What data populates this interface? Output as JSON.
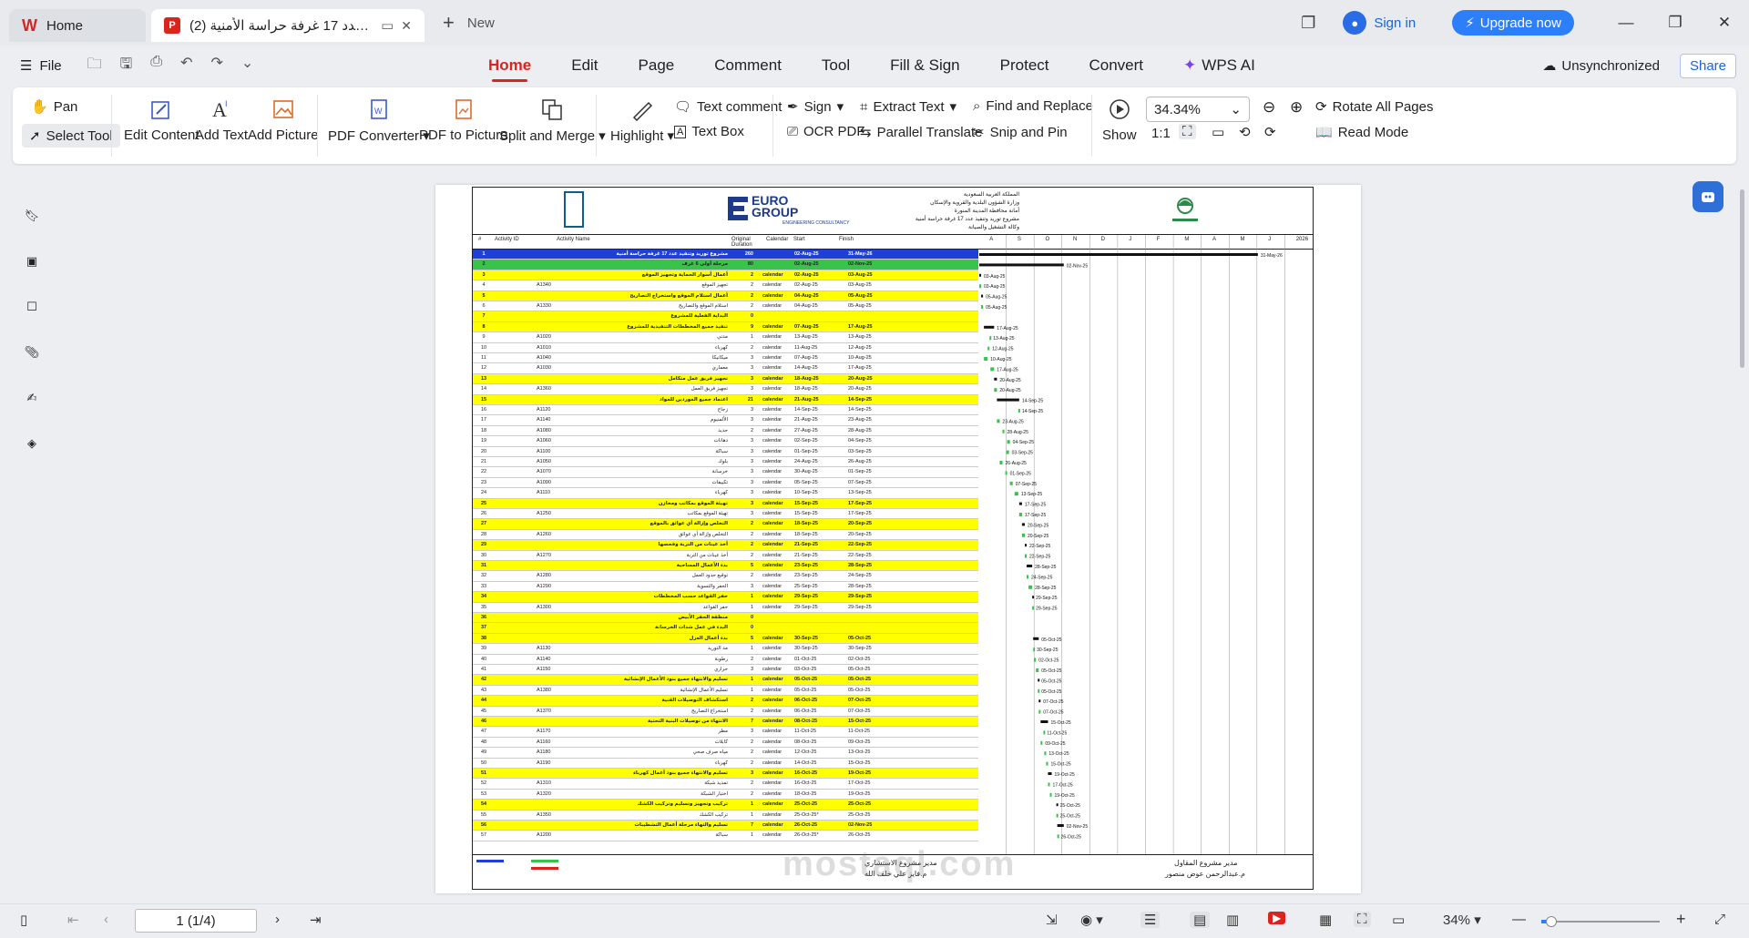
{
  "titlebar": {
    "home_tab": "Home",
    "doc_tab": "مشروع توريد وتنفيذ عدد 17 غرفة حراسة الأمنية (2)",
    "new_tab": "New",
    "sign_in": "Sign in",
    "upgrade": "Upgrade now"
  },
  "menubar": {
    "file": "File",
    "tabs": [
      "Home",
      "Edit",
      "Page",
      "Comment",
      "Tool",
      "Fill & Sign",
      "Protect",
      "Convert",
      "WPS AI"
    ],
    "unsync": "Unsynchronized",
    "share": "Share"
  },
  "ribbon": {
    "pan": "Pan",
    "select_tool": "Select Tool",
    "edit_content": "Edit Content",
    "add_text": "Add Text",
    "add_picture": "Add Picture",
    "pdf_converter": "PDF Converter",
    "pdf_to_picture": "PDF to Picture",
    "split_merge": "Split and Merge",
    "highlight": "Highlight",
    "text_comment": "Text comment",
    "text_box": "Text Box",
    "sign": "Sign",
    "ocr_pdf": "OCR PDF",
    "extract_text": "Extract Text",
    "parallel_translate": "Parallel Translate",
    "find_replace": "Find and Replace",
    "snip_pin": "Snip and Pin",
    "show": "Show",
    "zoom_value": "34.34%",
    "rotate_all": "Rotate All Pages",
    "read_mode": "Read Mode"
  },
  "document": {
    "company": "EURO\nGROUP",
    "company_sub": "ENGINEERING CONSULTANCY",
    "header_ar": "المملكة العربية السعودية\nوزارة الشؤون البلدية والقروية والإسكان\nأمانة محافظة المدينة المنورة\nمشروع توريد وتنفيذ عدد 17 غرفة حراسة أمنية\nوكالة التشغيل والصيانة",
    "col_headers": [
      "#",
      "Activity ID",
      "Activity Name",
      "Original Duration",
      "Calendar",
      "Start",
      "Finish"
    ],
    "months": [
      "A",
      "S",
      "O",
      "N",
      "D",
      "J",
      "F",
      "M",
      "A",
      "M",
      "J",
      "2026"
    ],
    "rows": [
      {
        "n": "1",
        "aid": "",
        "name": "مشروع توريد وتنفيذ عدد 17 غرفة حراسة أمنية",
        "dur": "260",
        "cal": "",
        "st": "02-Aug-25",
        "fi": "31-May-26",
        "lvl": "project"
      },
      {
        "n": "2",
        "aid": "",
        "name": "مرحلة أولى 6 غرف",
        "dur": "80",
        "cal": "",
        "st": "02-Aug-25",
        "fi": "02-Nov-25",
        "lvl": "phase"
      },
      {
        "n": "3",
        "aid": "",
        "name": "أعمال أسوار الحماية وتجهيز الموقع",
        "dur": "2",
        "cal": "calendar",
        "st": "02-Aug-25",
        "fi": "03-Aug-25",
        "lvl": "wbs"
      },
      {
        "n": "4",
        "aid": "A1340",
        "name": "تجهيز الموقع",
        "dur": "2",
        "cal": "calendar",
        "st": "02-Aug-25",
        "fi": "03-Aug-25",
        "lvl": "act"
      },
      {
        "n": "5",
        "aid": "",
        "name": "أعمال استلام الموقع واستخراج التصاريح",
        "dur": "2",
        "cal": "calendar",
        "st": "04-Aug-25",
        "fi": "05-Aug-25",
        "lvl": "wbs"
      },
      {
        "n": "6",
        "aid": "A1330",
        "name": "استلام الموقع والتصاريح",
        "dur": "2",
        "cal": "calendar",
        "st": "04-Aug-25",
        "fi": "05-Aug-25",
        "lvl": "act"
      },
      {
        "n": "7",
        "aid": "",
        "name": "البداية الفعلية للمشروع",
        "dur": "0",
        "cal": "",
        "st": "",
        "fi": "",
        "lvl": "wbs"
      },
      {
        "n": "8",
        "aid": "",
        "name": "تنفيذ جميع المخططات التنفيذية للمشروع",
        "dur": "9",
        "cal": "calendar",
        "st": "07-Aug-25",
        "fi": "17-Aug-25",
        "lvl": "wbs"
      },
      {
        "n": "9",
        "aid": "A1020",
        "name": "مدني",
        "dur": "1",
        "cal": "calendar",
        "st": "13-Aug-25",
        "fi": "13-Aug-25",
        "lvl": "act"
      },
      {
        "n": "10",
        "aid": "A1010",
        "name": "كهرباء",
        "dur": "2",
        "cal": "calendar",
        "st": "11-Aug-25",
        "fi": "12-Aug-25",
        "lvl": "act"
      },
      {
        "n": "11",
        "aid": "A1040",
        "name": "ميكانيكا",
        "dur": "3",
        "cal": "calendar",
        "st": "07-Aug-25",
        "fi": "10-Aug-25",
        "lvl": "act"
      },
      {
        "n": "12",
        "aid": "A1030",
        "name": "معماري",
        "dur": "3",
        "cal": "calendar",
        "st": "14-Aug-25",
        "fi": "17-Aug-25",
        "lvl": "act"
      },
      {
        "n": "13",
        "aid": "",
        "name": "تجهيز فريق عمل متكامل",
        "dur": "3",
        "cal": "calendar",
        "st": "18-Aug-25",
        "fi": "20-Aug-25",
        "lvl": "wbs"
      },
      {
        "n": "14",
        "aid": "A1360",
        "name": "تجهيز فريق العمل",
        "dur": "3",
        "cal": "calendar",
        "st": "18-Aug-25",
        "fi": "20-Aug-25",
        "lvl": "act"
      },
      {
        "n": "15",
        "aid": "",
        "name": "اعتماد جميع الموردين للمواد",
        "dur": "21",
        "cal": "calendar",
        "st": "21-Aug-25",
        "fi": "14-Sep-25",
        "lvl": "wbs"
      },
      {
        "n": "16",
        "aid": "A1120",
        "name": "زجاج",
        "dur": "3",
        "cal": "calendar",
        "st": "14-Sep-25",
        "fi": "14-Sep-25",
        "lvl": "act"
      },
      {
        "n": "17",
        "aid": "A1140",
        "name": "الألمنيوم",
        "dur": "3",
        "cal": "calendar",
        "st": "21-Aug-25",
        "fi": "23-Aug-25",
        "lvl": "act"
      },
      {
        "n": "18",
        "aid": "A1080",
        "name": "حديد",
        "dur": "2",
        "cal": "calendar",
        "st": "27-Aug-25",
        "fi": "28-Aug-25",
        "lvl": "act"
      },
      {
        "n": "19",
        "aid": "A1060",
        "name": "دهانات",
        "dur": "3",
        "cal": "calendar",
        "st": "02-Sep-25",
        "fi": "04-Sep-25",
        "lvl": "act"
      },
      {
        "n": "20",
        "aid": "A1100",
        "name": "سباكة",
        "dur": "3",
        "cal": "calendar",
        "st": "01-Sep-25",
        "fi": "03-Sep-25",
        "lvl": "act"
      },
      {
        "n": "21",
        "aid": "A1050",
        "name": "بلوك",
        "dur": "3",
        "cal": "calendar",
        "st": "24-Aug-25",
        "fi": "26-Aug-25",
        "lvl": "act"
      },
      {
        "n": "22",
        "aid": "A1070",
        "name": "خرسانة",
        "dur": "3",
        "cal": "calendar",
        "st": "30-Aug-25",
        "fi": "01-Sep-25",
        "lvl": "act"
      },
      {
        "n": "23",
        "aid": "A1090",
        "name": "تكييفات",
        "dur": "3",
        "cal": "calendar",
        "st": "05-Sep-25",
        "fi": "07-Sep-25",
        "lvl": "act"
      },
      {
        "n": "24",
        "aid": "A1110",
        "name": "كهرباء",
        "dur": "3",
        "cal": "calendar",
        "st": "10-Sep-25",
        "fi": "13-Sep-25",
        "lvl": "act"
      },
      {
        "n": "25",
        "aid": "",
        "name": "تهيئة الموقع بمكاتب ومخازن",
        "dur": "3",
        "cal": "calendar",
        "st": "15-Sep-25",
        "fi": "17-Sep-25",
        "lvl": "wbs"
      },
      {
        "n": "26",
        "aid": "A1250",
        "name": "تهيئة الموقع بمكاتب",
        "dur": "3",
        "cal": "calendar",
        "st": "15-Sep-25",
        "fi": "17-Sep-25",
        "lvl": "act"
      },
      {
        "n": "27",
        "aid": "",
        "name": "التخلص وإزالة أي عوائق بالموقع",
        "dur": "2",
        "cal": "calendar",
        "st": "18-Sep-25",
        "fi": "20-Sep-25",
        "lvl": "wbs"
      },
      {
        "n": "28",
        "aid": "A1260",
        "name": "التخلص وإزالة أي عوائق",
        "dur": "2",
        "cal": "calendar",
        "st": "18-Sep-25",
        "fi": "20-Sep-25",
        "lvl": "act"
      },
      {
        "n": "29",
        "aid": "",
        "name": "أخذ عينات من التربة وفحصها",
        "dur": "2",
        "cal": "calendar",
        "st": "21-Sep-25",
        "fi": "22-Sep-25",
        "lvl": "wbs"
      },
      {
        "n": "30",
        "aid": "A1270",
        "name": "أخذ عينات من التربة",
        "dur": "2",
        "cal": "calendar",
        "st": "21-Sep-25",
        "fi": "22-Sep-25",
        "lvl": "act"
      },
      {
        "n": "31",
        "aid": "",
        "name": "بدء الأعمال المساحية",
        "dur": "5",
        "cal": "calendar",
        "st": "23-Sep-25",
        "fi": "28-Sep-25",
        "lvl": "wbs"
      },
      {
        "n": "32",
        "aid": "A1280",
        "name": "توقيع حدود العمل",
        "dur": "2",
        "cal": "calendar",
        "st": "23-Sep-25",
        "fi": "24-Sep-25",
        "lvl": "act"
      },
      {
        "n": "33",
        "aid": "A1290",
        "name": "الحفر والتسوية",
        "dur": "3",
        "cal": "calendar",
        "st": "25-Sep-25",
        "fi": "28-Sep-25",
        "lvl": "act"
      },
      {
        "n": "34",
        "aid": "",
        "name": "حفر القواعد حسب المخططات",
        "dur": "1",
        "cal": "calendar",
        "st": "29-Sep-25",
        "fi": "29-Sep-25",
        "lvl": "wbs"
      },
      {
        "n": "35",
        "aid": "A1300",
        "name": "حفر القواعد",
        "dur": "1",
        "cal": "calendar",
        "st": "29-Sep-25",
        "fi": "29-Sep-25",
        "lvl": "act"
      },
      {
        "n": "36",
        "aid": "",
        "name": "منظفة الحفر الأبيض",
        "dur": "0",
        "cal": "",
        "st": "",
        "fi": "",
        "lvl": "wbs"
      },
      {
        "n": "37",
        "aid": "",
        "name": "البدء في عمل شدات الخرسانة",
        "dur": "0",
        "cal": "",
        "st": "",
        "fi": "",
        "lvl": "wbs"
      },
      {
        "n": "38",
        "aid": "",
        "name": "بدء أعمال العزل",
        "dur": "5",
        "cal": "calendar",
        "st": "30-Sep-25",
        "fi": "05-Oct-25",
        "lvl": "wbs"
      },
      {
        "n": "39",
        "aid": "A1130",
        "name": "مد التوريد",
        "dur": "1",
        "cal": "calendar",
        "st": "30-Sep-25",
        "fi": "30-Sep-25",
        "lvl": "act"
      },
      {
        "n": "40",
        "aid": "A1140",
        "name": "رطوبة",
        "dur": "2",
        "cal": "calendar",
        "st": "01-Oct-25",
        "fi": "02-Oct-25",
        "lvl": "act"
      },
      {
        "n": "41",
        "aid": "A1150",
        "name": "حراري",
        "dur": "3",
        "cal": "calendar",
        "st": "03-Oct-25",
        "fi": "05-Oct-25",
        "lvl": "act"
      },
      {
        "n": "42",
        "aid": "",
        "name": "تسليم والانتهاء جميع بنود الأعمال الإنشائية",
        "dur": "1",
        "cal": "calendar",
        "st": "05-Oct-25",
        "fi": "05-Oct-25",
        "lvl": "wbs"
      },
      {
        "n": "43",
        "aid": "A1380",
        "name": "تسليم الأعمال الإنشائية",
        "dur": "1",
        "cal": "calendar",
        "st": "05-Oct-25",
        "fi": "05-Oct-25",
        "lvl": "act"
      },
      {
        "n": "44",
        "aid": "",
        "name": "استكشاف التوصيلات الفنية",
        "dur": "2",
        "cal": "calendar",
        "st": "06-Oct-25",
        "fi": "07-Oct-25",
        "lvl": "wbs"
      },
      {
        "n": "45",
        "aid": "A1370",
        "name": "استخراج التصاريح",
        "dur": "2",
        "cal": "calendar",
        "st": "06-Oct-25",
        "fi": "07-Oct-25",
        "lvl": "act"
      },
      {
        "n": "46",
        "aid": "",
        "name": "الانتهاء من توصيلات البنية التحتية",
        "dur": "7",
        "cal": "calendar",
        "st": "08-Oct-25",
        "fi": "15-Oct-25",
        "lvl": "wbs"
      },
      {
        "n": "47",
        "aid": "A1170",
        "name": "مطر",
        "dur": "3",
        "cal": "calendar",
        "st": "11-Oct-25",
        "fi": "11-Oct-25",
        "lvl": "act"
      },
      {
        "n": "48",
        "aid": "A1160",
        "name": "كابلات",
        "dur": "2",
        "cal": "calendar",
        "st": "08-Oct-25",
        "fi": "09-Oct-25",
        "lvl": "act"
      },
      {
        "n": "49",
        "aid": "A1180",
        "name": "مياه صرف صحي",
        "dur": "2",
        "cal": "calendar",
        "st": "12-Oct-25",
        "fi": "13-Oct-25",
        "lvl": "act"
      },
      {
        "n": "50",
        "aid": "A1190",
        "name": "كهرباء",
        "dur": "2",
        "cal": "calendar",
        "st": "14-Oct-25",
        "fi": "15-Oct-25",
        "lvl": "act"
      },
      {
        "n": "51",
        "aid": "",
        "name": "تسليم والانتهاء جميع بنود أعمال كهرباء",
        "dur": "3",
        "cal": "calendar",
        "st": "16-Oct-25",
        "fi": "19-Oct-25",
        "lvl": "wbs"
      },
      {
        "n": "52",
        "aid": "A1310",
        "name": "تمديد شبكة",
        "dur": "2",
        "cal": "calendar",
        "st": "16-Oct-25",
        "fi": "17-Oct-25",
        "lvl": "act"
      },
      {
        "n": "53",
        "aid": "A1320",
        "name": "اختبار الشبكة",
        "dur": "2",
        "cal": "calendar",
        "st": "18-Oct-25",
        "fi": "19-Oct-25",
        "lvl": "act"
      },
      {
        "n": "54",
        "aid": "",
        "name": "تركيب وتجهيز وتسليم وتركيب الكشك",
        "dur": "1",
        "cal": "calendar",
        "st": "25-Oct-25",
        "fi": "25-Oct-25",
        "lvl": "wbs"
      },
      {
        "n": "55",
        "aid": "A1350",
        "name": "تركيب الكشك",
        "dur": "1",
        "cal": "calendar",
        "st": "25-Oct-25*",
        "fi": "25-Oct-25",
        "lvl": "act"
      },
      {
        "n": "56",
        "aid": "",
        "name": "تسليم والتهاء مرحلة أعمال التشطيبات",
        "dur": "7",
        "cal": "calendar",
        "st": "26-Oct-25",
        "fi": "02-Nov-25",
        "lvl": "wbs"
      },
      {
        "n": "57",
        "aid": "A1200",
        "name": "سباكة",
        "dur": "1",
        "cal": "calendar",
        "st": "26-Oct-25*",
        "fi": "26-Oct-25",
        "lvl": "act"
      }
    ],
    "footer_left_1": "مدير مشروع الاستشاري",
    "footer_left_2": "م.فايز علي خلف الله",
    "footer_right_1": "مدير مشروع المقاول",
    "footer_right_2": "م.عبدالرحمن عوض منصور",
    "watermark": "mostaql.com"
  },
  "statusbar": {
    "page": "1 (1/4)",
    "zoom": "34%"
  },
  "colors": {
    "accent": "#d9251d",
    "link": "#1a66d4",
    "upgrade": "#2d7ff9",
    "project_row": "#1f3fd6",
    "phase_row": "#38c44a",
    "wbs_row": "#ffff00"
  }
}
